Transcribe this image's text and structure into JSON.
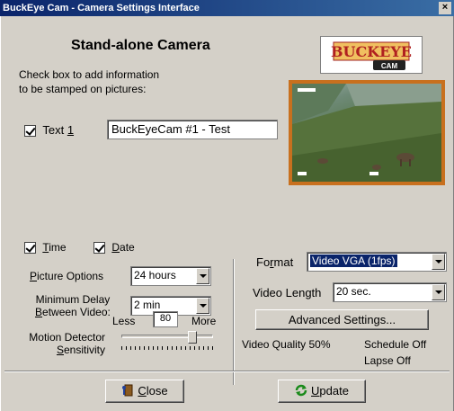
{
  "window": {
    "title": "BuckEye Cam - Camera Settings Interface",
    "close_glyph": "×"
  },
  "header": {
    "heading": "Stand-alone Camera",
    "instruction_line1": "Check box to add information",
    "instruction_line2": "to be stamped on pictures:"
  },
  "logo": {
    "line1": "BUCKEYE",
    "line2": "CAM"
  },
  "text_stamp": {
    "label": "Text",
    "label_underlined": "1",
    "value": "BuckEyeCam #1 - Test",
    "checked": true
  },
  "stamps": {
    "time": {
      "label_u": "T",
      "label_rest": "ime",
      "checked": true
    },
    "date": {
      "label_u": "D",
      "label_rest": "ate",
      "checked": true
    }
  },
  "picture_options": {
    "label_u": "P",
    "label_rest": "icture Options",
    "value": "24 hours"
  },
  "min_delay": {
    "label_line1": "Minimum Delay",
    "label_u": "B",
    "label_rest": "etween Video:",
    "value": "2 min"
  },
  "motion": {
    "label_line1": "Motion Detector",
    "label_u": "S",
    "label_rest": "ensitivity",
    "less": "Less",
    "more": "More",
    "value": "80",
    "level_fraction": 0.8
  },
  "format": {
    "label_pre": "Fo",
    "label_u": "r",
    "label_rest": "mat",
    "value": "Video VGA (1fps)"
  },
  "video_length": {
    "label": "Video Length",
    "value": "20 sec."
  },
  "advanced_button": "Advanced Settings...",
  "status": {
    "video_quality": "Video Quality 50%",
    "schedule": "Schedule Off",
    "lapse": "Lapse Off"
  },
  "buttons": {
    "close_u": "C",
    "close_rest": "lose",
    "update_u": "U",
    "update_rest": "pdate"
  },
  "colors": {
    "title_bar": "#0a246a",
    "dialog_bg": "#d4d0c8",
    "photo_frame": "#c8701e",
    "selection": "#0a246a"
  }
}
